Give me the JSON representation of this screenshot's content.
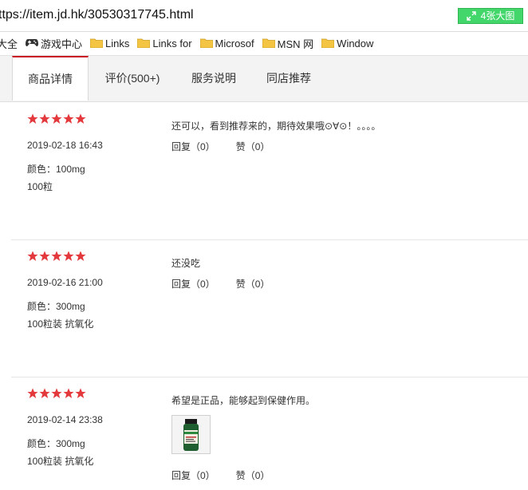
{
  "browser": {
    "url": "ttps://item.jd.hk/30530317745.html",
    "badge_label": "4张大图"
  },
  "bookmarks": [
    {
      "label": "大全",
      "icon": "none"
    },
    {
      "label": "游戏中心",
      "icon": "gamepad-icon"
    },
    {
      "label": "Links",
      "icon": "folder-icon"
    },
    {
      "label": "Links for",
      "icon": "folder-icon"
    },
    {
      "label": "Microsof",
      "icon": "folder-icon"
    },
    {
      "label": "MSN 网",
      "icon": "folder-icon"
    },
    {
      "label": "Window",
      "icon": "folder-icon"
    }
  ],
  "tabs": [
    {
      "label": "商品详情",
      "active": true
    },
    {
      "label": "评价(500+)",
      "active": false
    },
    {
      "label": "服务说明",
      "active": false
    },
    {
      "label": "同店推荐",
      "active": false
    }
  ],
  "reviews": [
    {
      "rating": 5,
      "date": "2019-02-18 16:43",
      "attr1": "颜色：100mg",
      "attr2": "100粒",
      "text": "还可以，看到推荐来的，期待效果哦⊙∀⊙！。。。。",
      "reply": "回复（0）",
      "like": "赞（0）",
      "has_image": false
    },
    {
      "rating": 5,
      "date": "2019-02-16 21:00",
      "attr1": "颜色：300mg",
      "attr2": "100粒装 抗氧化",
      "text": "还没吃",
      "reply": "回复（0）",
      "like": "赞（0）",
      "has_image": false
    },
    {
      "rating": 5,
      "date": "2019-02-14 23:38",
      "attr1": "颜色：300mg",
      "attr2": "100粒装 抗氧化",
      "text": "希望是正品，能够起到保健作用。",
      "reply": "回复（0）",
      "like": "赞（0）",
      "has_image": true
    }
  ],
  "colors": {
    "star": "#e4393c",
    "badge": "#43d66b",
    "tab_active_border": "#c81623"
  }
}
